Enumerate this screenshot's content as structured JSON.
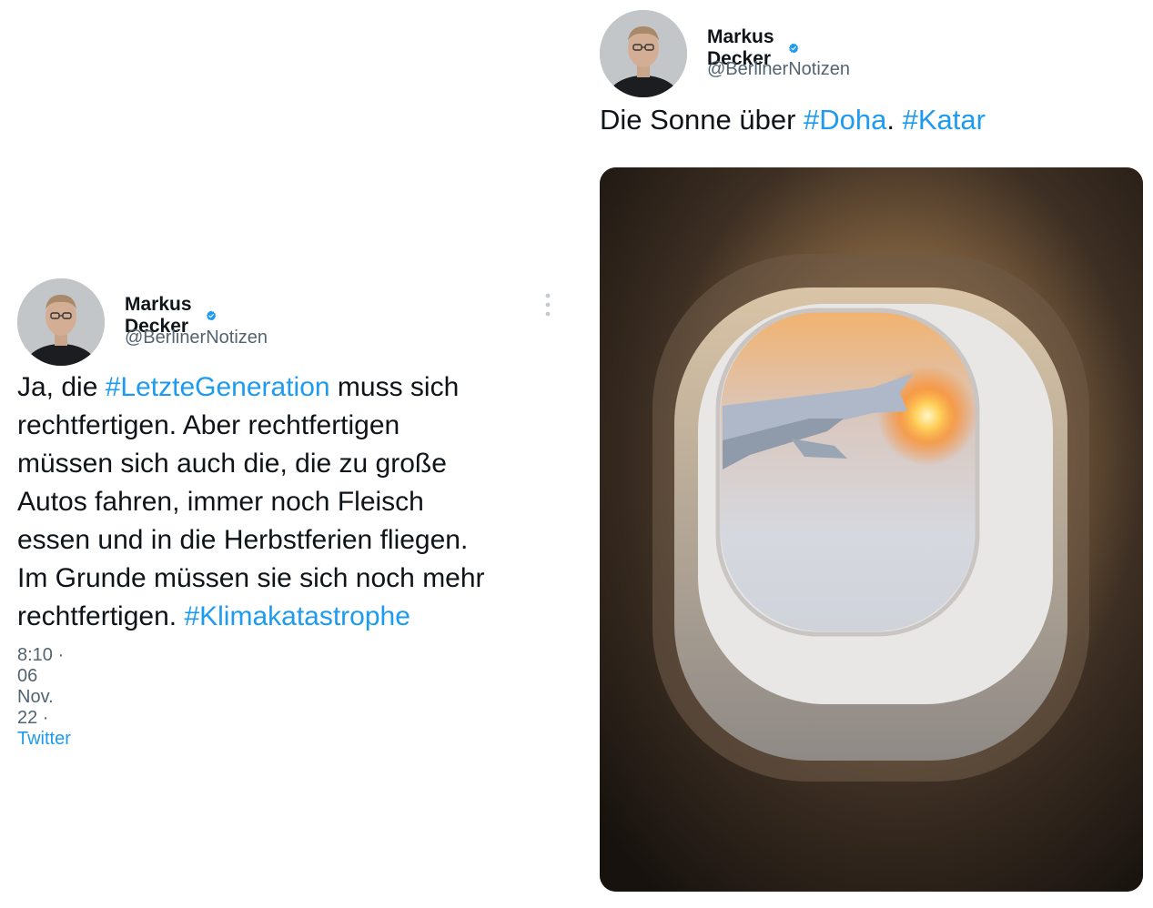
{
  "tweet_left": {
    "name": "Markus Decker",
    "handle": "@BerlinerNotizen",
    "text_lines": [
      [
        "Ja, die ",
        {
          "tag": "#LetzteGeneration"
        },
        " muss sich"
      ],
      [
        "rechtfertigen. Aber rechtfertigen"
      ],
      [
        "müssen sich auch die, die zu große"
      ],
      [
        "Autos fahren, immer noch Fleisch"
      ],
      [
        "essen und in die Herbstferien fliegen."
      ],
      [
        "Im Grunde müssen sie sich noch mehr"
      ],
      [
        "rechtfertigen. ",
        {
          "tag": "#Klimakatastrophe"
        }
      ]
    ],
    "time": "8:10",
    "sep1": " · ",
    "date": "06 Nov. 22",
    "sep2": " · ",
    "source": "Twitter"
  },
  "tweet_right": {
    "name": "Markus Decker",
    "handle": "@BerlinerNotizen",
    "text_prefix": "Die Sonne über ",
    "hashtag1": "#Doha",
    "text_mid": ". ",
    "hashtag2": "#Katar",
    "photo_icon": "airplane-window-sunset-photo"
  },
  "colors": {
    "hashtag": "#1d9bf0",
    "verified": "#1d9bf0",
    "secondary_text": "#536471"
  }
}
